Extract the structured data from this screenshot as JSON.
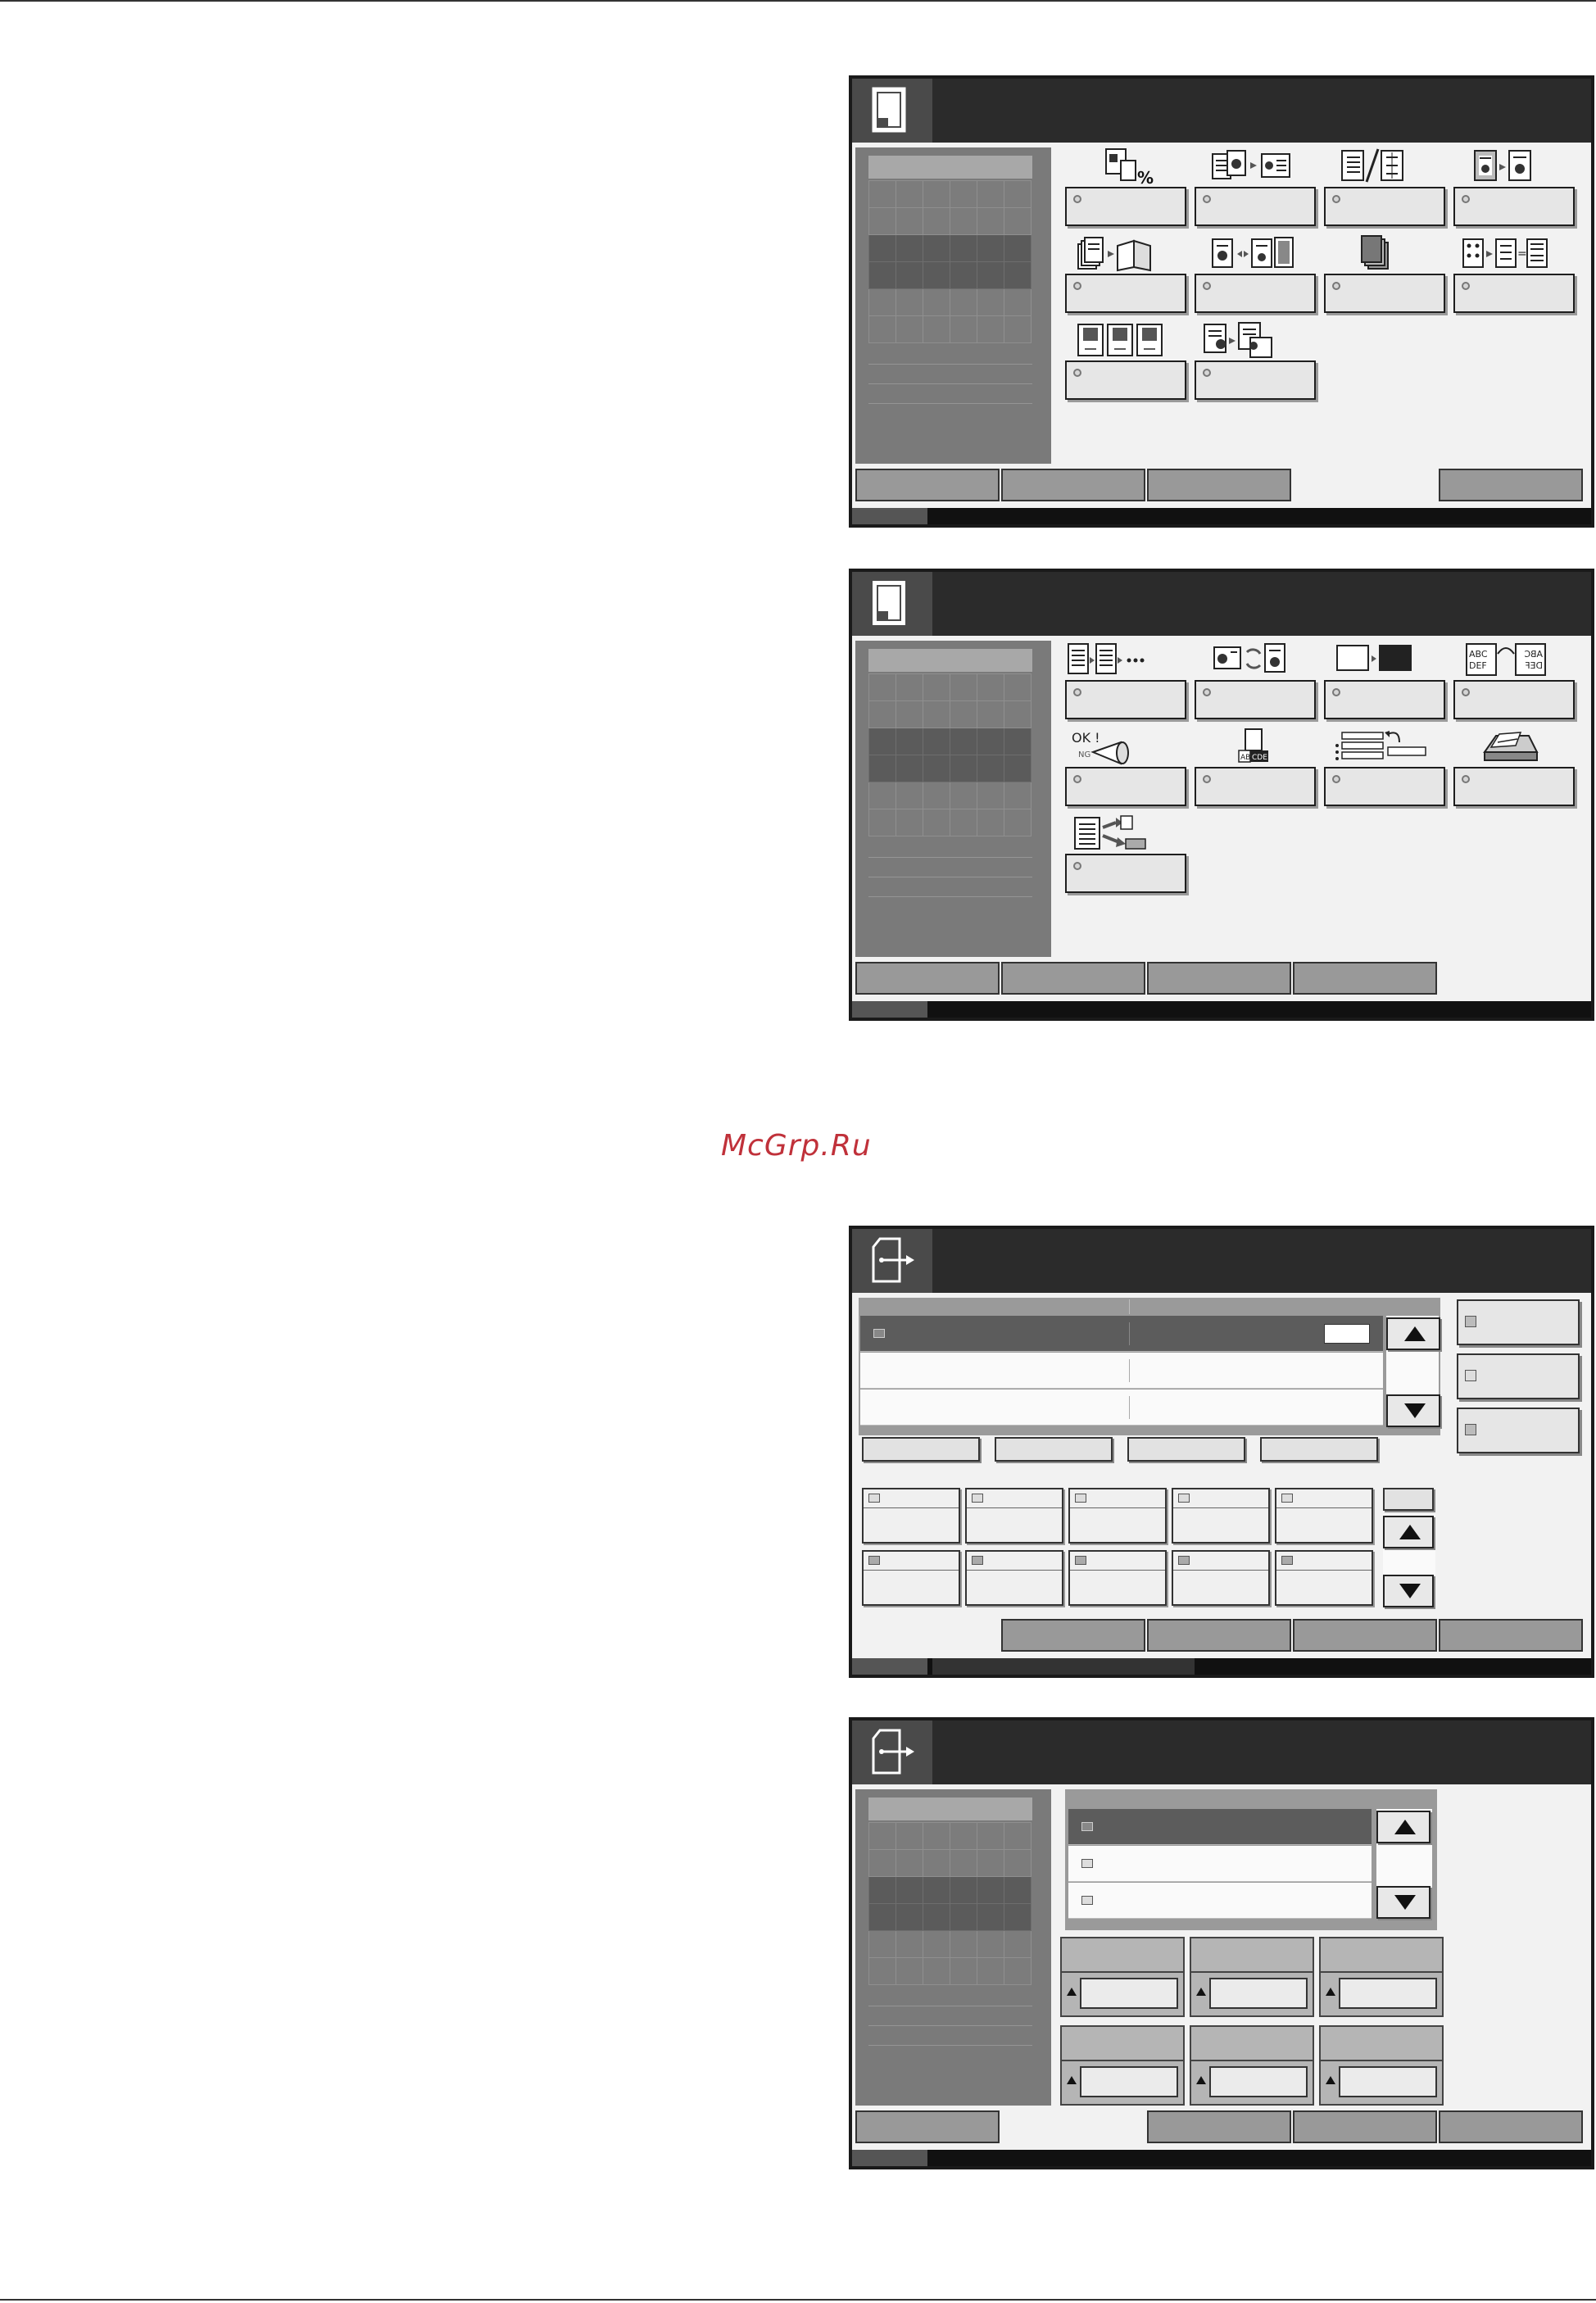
{
  "watermark": "McGrp.Ru",
  "screens": [
    {
      "id": "copy-functions-page-1",
      "icon": "copy-document-icon",
      "function_buttons": [
        {
          "icon": "zoom-percent-icon"
        },
        {
          "icon": "combine-originals-icon"
        },
        {
          "icon": "margin-shift-icon"
        },
        {
          "icon": "border-erase-icon"
        },
        {
          "icon": "booklet-icon"
        },
        {
          "icon": "duplex-copy-icon"
        },
        {
          "icon": "cover-sheet-icon"
        },
        {
          "icon": "n-up-layout-icon"
        },
        {
          "icon": "page-numbering-icon"
        },
        {
          "icon": "form-overlay-icon"
        }
      ],
      "tabs": [
        "",
        "",
        "",
        "",
        ""
      ],
      "active_tab": 3
    },
    {
      "id": "copy-functions-page-2",
      "icon": "copy-document-icon",
      "function_buttons": [
        {
          "icon": "continuous-scan-icon"
        },
        {
          "icon": "auto-rotation-icon"
        },
        {
          "icon": "negative-image-icon"
        },
        {
          "icon": "mirror-image-icon",
          "label": "ABC DEF"
        },
        {
          "icon": "job-finish-notice-icon",
          "label": "OK ! NG"
        },
        {
          "icon": "file-name-entry-icon",
          "label": "AB CDE"
        },
        {
          "icon": "job-priority-icon"
        },
        {
          "icon": "original-orientation-icon"
        },
        {
          "icon": "send-to-fax-icon"
        }
      ],
      "neg_label_left": "ABC",
      "neg_label_right": "ABC",
      "tabs": [
        "",
        "",
        "",
        "",
        ""
      ],
      "active_tab": 4
    },
    {
      "id": "send-destination",
      "icon": "send-document-icon",
      "destinations": [
        {
          "icon": "email-icon",
          "selected": true
        },
        {
          "icon": "",
          "selected": false
        },
        {
          "icon": "",
          "selected": false
        }
      ],
      "side_buttons": [
        {
          "icon": "address-book-icon"
        },
        {
          "icon": "email-entry-icon"
        },
        {
          "icon": "folder-entry-icon"
        }
      ],
      "tabs": [
        "",
        "",
        "",
        "",
        ""
      ],
      "active_tab": 0
    },
    {
      "id": "send-settings",
      "icon": "send-document-icon",
      "list_items": [
        {
          "icon": "email-icon",
          "selected": true
        },
        {
          "icon": "email-icon",
          "selected": false
        },
        {
          "icon": "email-icon",
          "selected": false
        }
      ],
      "tabs": [
        "",
        "",
        "",
        "",
        ""
      ],
      "active_tab": 1
    }
  ]
}
